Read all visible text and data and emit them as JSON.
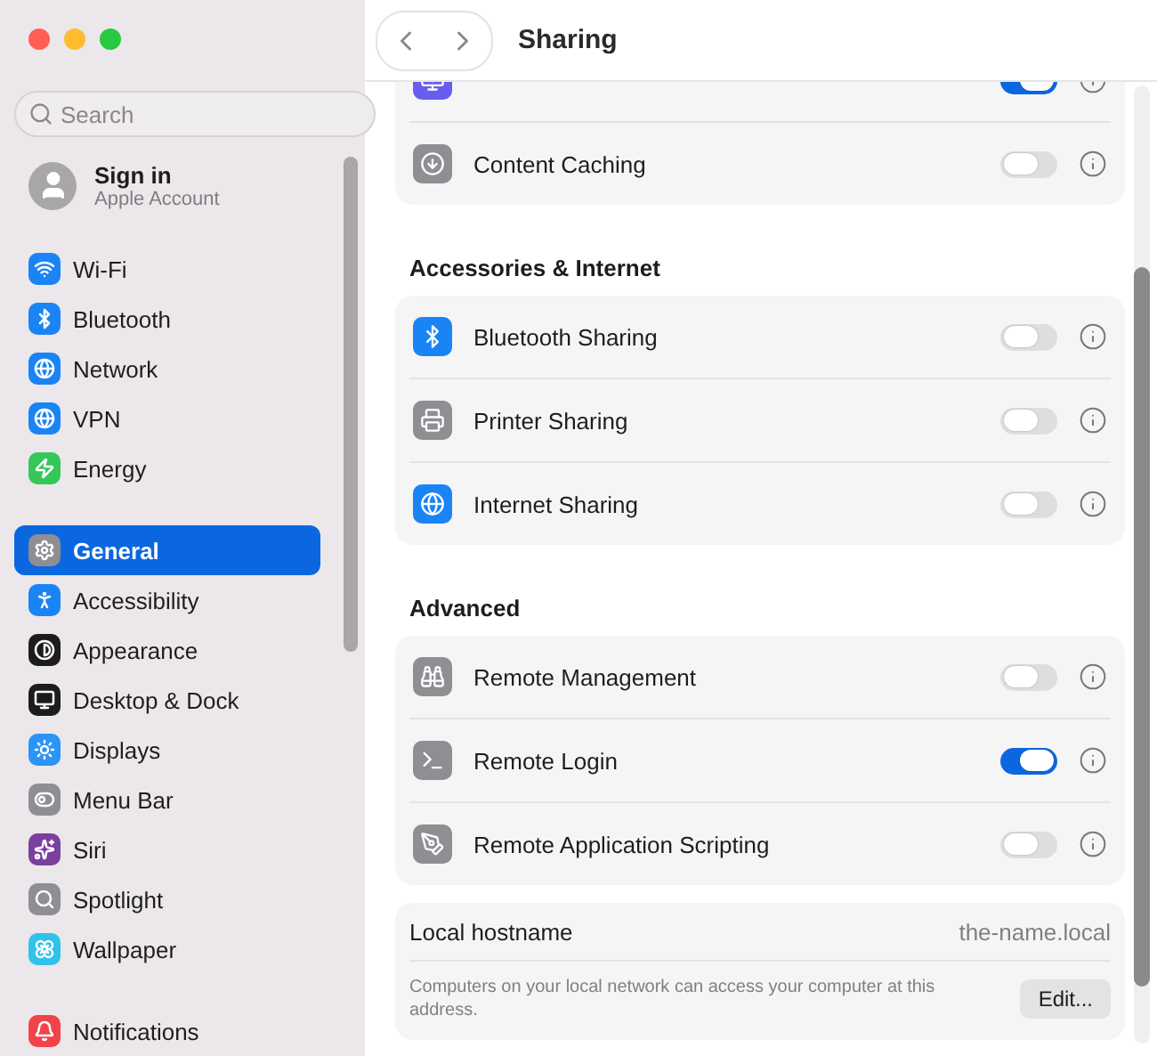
{
  "window": {
    "title": "Sharing"
  },
  "search": {
    "placeholder": "Search"
  },
  "account": {
    "name": "Sign in",
    "subtitle": "Apple Account"
  },
  "sidebar": {
    "groups": [
      [
        {
          "label": "Wi-Fi",
          "color": "#1a84f5",
          "selected": false
        },
        {
          "label": "Bluetooth",
          "color": "#1a84f5",
          "selected": false
        },
        {
          "label": "Network",
          "color": "#1a84f5",
          "selected": false
        },
        {
          "label": "VPN",
          "color": "#1a84f5",
          "selected": false
        },
        {
          "label": "Energy",
          "color": "#34c759",
          "selected": false
        }
      ],
      [
        {
          "label": "General",
          "color": "#8e8e93",
          "selected": true
        },
        {
          "label": "Accessibility",
          "color": "#1a84f5",
          "selected": false
        },
        {
          "label": "Appearance",
          "color": "#1c1c1e",
          "selected": false
        },
        {
          "label": "Desktop & Dock",
          "color": "#1c1c1e",
          "selected": false
        },
        {
          "label": "Displays",
          "color": "#2a94f7",
          "selected": false
        },
        {
          "label": "Menu Bar",
          "color": "#8e8e93",
          "selected": false
        },
        {
          "label": "Siri",
          "color": "#7b3fa0",
          "selected": false
        },
        {
          "label": "Spotlight",
          "color": "#8e8e93",
          "selected": false
        },
        {
          "label": "Wallpaper",
          "color": "#30c2e8",
          "selected": false
        }
      ],
      [
        {
          "label": "Notifications",
          "color": "#f2434a",
          "selected": false
        }
      ]
    ]
  },
  "sections": [
    {
      "rows": [
        {
          "color": "#6b5cf0",
          "on": true
        },
        {
          "label": "Content Caching",
          "color": "#8e8e93",
          "on": false
        }
      ]
    },
    {
      "heading": "Accessories & Internet",
      "rows": [
        {
          "label": "Bluetooth Sharing",
          "color": "#1a84f5",
          "on": false
        },
        {
          "label": "Printer Sharing",
          "color": "#8e8e93",
          "on": false
        },
        {
          "label": "Internet Sharing",
          "color": "#1a84f5",
          "on": false
        }
      ]
    },
    {
      "heading": "Advanced",
      "rows": [
        {
          "label": "Remote Management",
          "color": "#8e8e93",
          "on": false
        },
        {
          "label": "Remote Login",
          "color": "#8e8e93",
          "on": true
        },
        {
          "label": "Remote Application Scripting",
          "color": "#8e8e93",
          "on": false
        }
      ]
    }
  ],
  "hostname": {
    "label": "Local hostname",
    "value": "the-name.local",
    "note": "Computers on your local network can access your computer at this address.",
    "button": "Edit..."
  }
}
